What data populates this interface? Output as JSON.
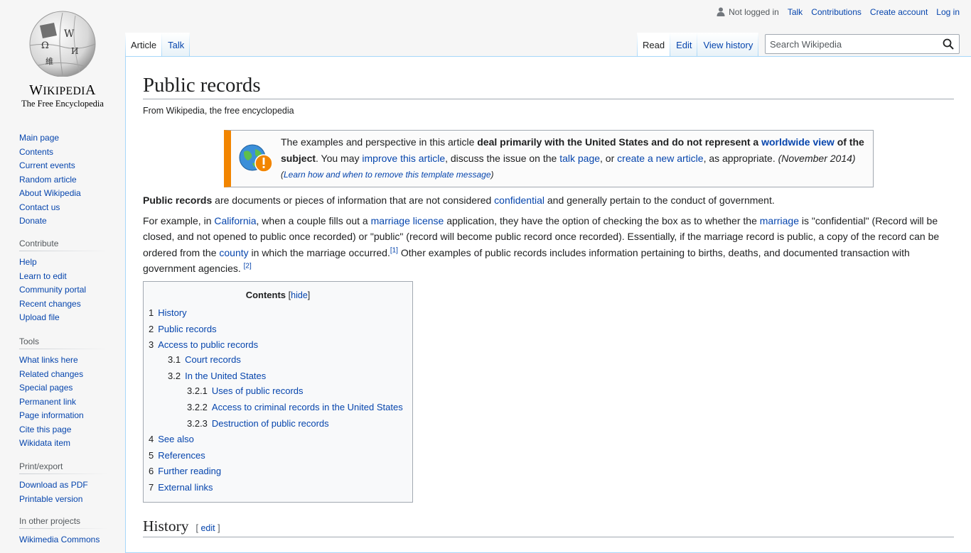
{
  "logo": {
    "wordmark": "Wikipedia",
    "tagline": "The Free Encyclopedia",
    "globe_glyphs": [
      "Ω",
      "W",
      "維",
      "И"
    ]
  },
  "personal_tools": {
    "not_logged_in": "Not logged in",
    "talk": "Talk",
    "contributions": "Contributions",
    "create_account": "Create account",
    "log_in": "Log in"
  },
  "tabs": {
    "left": [
      "Article",
      "Talk"
    ],
    "right": [
      "Read",
      "Edit",
      "View history"
    ]
  },
  "search": {
    "placeholder": "Search Wikipedia"
  },
  "sidebar": {
    "navigation": [
      "Main page",
      "Contents",
      "Current events",
      "Random article",
      "About Wikipedia",
      "Contact us",
      "Donate"
    ],
    "contribute": {
      "heading": "Contribute",
      "items": [
        "Help",
        "Learn to edit",
        "Community portal",
        "Recent changes",
        "Upload file"
      ]
    },
    "tools": {
      "heading": "Tools",
      "items": [
        "What links here",
        "Related changes",
        "Special pages",
        "Permanent link",
        "Page information",
        "Cite this page",
        "Wikidata item"
      ]
    },
    "print": {
      "heading": "Print/export",
      "items": [
        "Download as PDF",
        "Printable version"
      ]
    },
    "projects": {
      "heading": "In other projects",
      "items": [
        "Wikimedia Commons"
      ]
    }
  },
  "article": {
    "title": "Public records",
    "site_sub": "From Wikipedia, the free encyclopedia",
    "ambox": {
      "t1": "The examples and perspective in this article ",
      "t2": "deal primarily with the United States and do not represent a ",
      "t3": "worldwide view",
      "t4": " of the subject",
      "t5": ". You may ",
      "t6": "improve this article",
      "t7": ", discuss the issue on the ",
      "t8": "talk page",
      "t9": ", or ",
      "t10": "create a new article",
      "t11": ", as appropriate. ",
      "t12": "(November 2014)",
      "sub": "Learn how and when to remove this template message"
    },
    "para1": {
      "bold": "Public records",
      "t1": " are documents or pieces of information that are not considered ",
      "link1": "confidential",
      "t2": " and generally pertain to the conduct of government."
    },
    "para2": {
      "t1": "For example, in ",
      "link1": "California",
      "t2": ", when a couple fills out a ",
      "link2": "marriage license",
      "t3": " application, they have the option of checking the box as to whether the ",
      "link3": "marriage",
      "t4": " is \"confidential\" (Record will be closed, and not opened to public once recorded) or \"public\" (record will become public record once recorded). Essentially, if the marriage record is public, a copy of the record can be ordered from the ",
      "link4": "county",
      "t5": " in which the marriage occurred.",
      "ref1": "[1]",
      "t6": " Other examples of public records includes information pertaining to births, deaths, and documented transaction with government agencies. ",
      "ref2": "[2]"
    },
    "toc": {
      "title": "Contents",
      "toggle": "hide",
      "items": [
        {
          "num": "1",
          "text": "History"
        },
        {
          "num": "2",
          "text": "Public records"
        },
        {
          "num": "3",
          "text": "Access to public records"
        },
        {
          "num": "3.1",
          "text": "Court records"
        },
        {
          "num": "3.2",
          "text": "In the United States"
        },
        {
          "num": "3.2.1",
          "text": "Uses of public records"
        },
        {
          "num": "3.2.2",
          "text": "Access to criminal records in the United States"
        },
        {
          "num": "3.2.3",
          "text": "Destruction of public records"
        },
        {
          "num": "4",
          "text": "See also"
        },
        {
          "num": "5",
          "text": "References"
        },
        {
          "num": "6",
          "text": "Further reading"
        },
        {
          "num": "7",
          "text": "External links"
        }
      ]
    },
    "history": {
      "heading": "History",
      "edit": "edit"
    }
  },
  "colors": {
    "link": "#0645ad",
    "ambox_stripe": "#f28500",
    "tab_border": "#a7d7f9"
  }
}
